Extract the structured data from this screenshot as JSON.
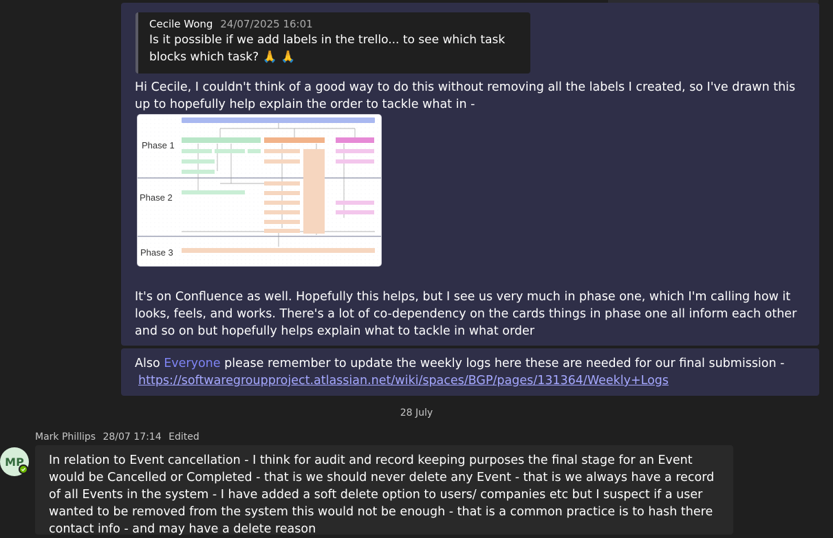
{
  "quote": {
    "author": "Cecile Wong",
    "timestamp": "24/07/2025 16:01",
    "text": "Is it possible if we add labels in the trello... to see which task blocks which task? 🙏 🙏"
  },
  "reply": {
    "intro": "Hi Cecile, I couldn't think of a good way to do this without removing all the labels I created, so I've drawn this up to hopefully help explain the order to tackle what in -",
    "after_image": "It's on Confluence as well. Hopefully this helps, but I see us very much in phase one, which I'm calling how it looks, feels, and works. There's a lot of co-dependency on the cards things in phase one all inform each other and so on but hopefully helps explain what to tackle in what order"
  },
  "diagram": {
    "phases": [
      "Phase 1",
      "Phase 2",
      "Phase 3"
    ]
  },
  "second_message": {
    "prefix": "Also ",
    "mention": "Everyone",
    "text": " please remember to update the weekly logs here these are needed for our final submission -",
    "link": "https://softwaregroupproject.atlassian.net/wiki/spaces/BGP/pages/131364/Weekly+Logs"
  },
  "date_separator": "28 July",
  "mark_message": {
    "author": "Mark Phillips",
    "timestamp": "28/07 17:14",
    "edited": "Edited",
    "avatar_initials": "MP",
    "text": "In relation to Event cancellation - I think for audit and record keeping purposes the final stage for an Event would be Cancelled or Completed  - that is we should never delete any Event - that is we always have a record of all Events  in the system - I have added a soft delete option to users/ companies etc but I suspect if a user wanted to be removed from the system this would not be enough - that is a common practice is to hash there contact info - and may have a delete reason"
  }
}
